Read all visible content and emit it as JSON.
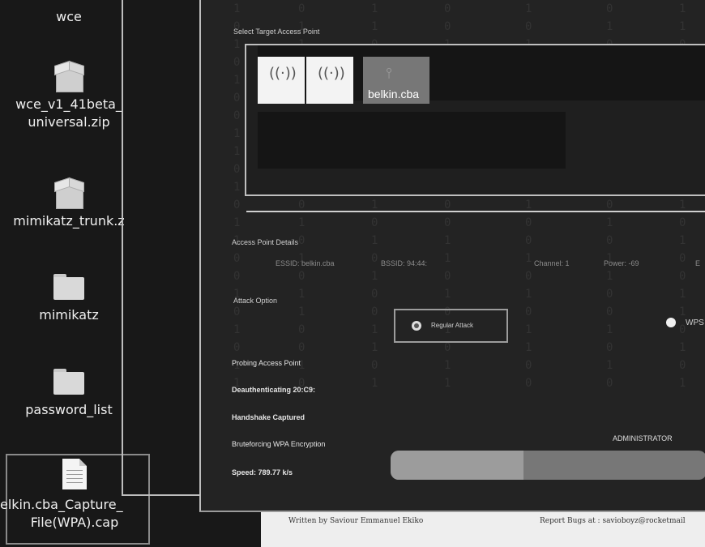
{
  "desktop": {
    "icons": [
      {
        "name": "wce",
        "type": "archive"
      },
      {
        "name": "wce_v1_41beta_universal.zip",
        "line1": "wce_v1_41beta_",
        "line2": "universal.zip",
        "type": "archive"
      },
      {
        "name": "mimikatz_trunk.z",
        "type": "archive"
      },
      {
        "name": "mimikatz",
        "type": "folder"
      },
      {
        "name": "password_list",
        "type": "folder"
      },
      {
        "name": "belkin.cba_Capture_File(WPA).cap",
        "line1": "elkin.cba_Capture_",
        "line2": "File(WPA).cap",
        "type": "document"
      }
    ]
  },
  "app": {
    "select_label": "Select Target Access Point",
    "access_points": [
      {
        "label": ""
      },
      {
        "label": ""
      },
      {
        "label": "belkin.cba",
        "selected": true
      }
    ],
    "details_label": "Access Point Details",
    "details": {
      "essid": "ESSID: belkin.cba",
      "bssid": "BSSID: 94:44:",
      "channel": "Channel: 1",
      "power": "Power: -69",
      "extra": "E"
    },
    "attack_label": "Attack Option",
    "regular_attack": "Regular Attack",
    "wps_attack": "WPS",
    "status_lines": [
      "Probing Access Point",
      "Deauthenticating 20:C9:",
      "Handshake Captured",
      "Bruteforcing WPA Encryption",
      "Speed: 789.77 k/s"
    ],
    "current_key": "ADMINISTRATOR",
    "progress": 0.42
  },
  "footer": {
    "written_by": "Written by Saviour Emmanuel Ekiko",
    "report_bugs": "Report Bugs at : savioboyz@rocketmail"
  }
}
